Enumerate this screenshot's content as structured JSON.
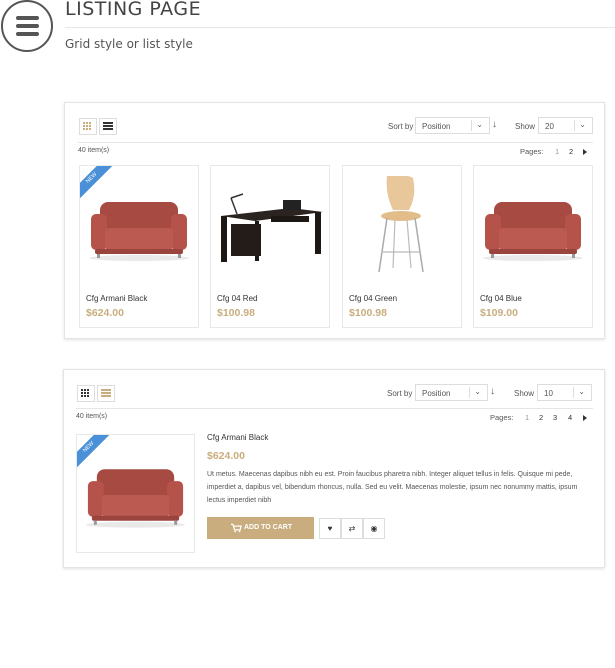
{
  "header": {
    "title": "LISTING PAGE",
    "subtitle": "Grid style or list style"
  },
  "grid_panel": {
    "sort_label": "Sort by",
    "sort_value": "Position",
    "show_label": "Show",
    "show_value": "20",
    "count": "40 item(s)",
    "pages_label": "Pages:",
    "pages": [
      "1",
      "2"
    ],
    "current_page": "1",
    "products": [
      {
        "name": "Cfg Armani Black",
        "price": "$624.00",
        "image": "red-sofa",
        "badge": "NEW"
      },
      {
        "name": "Cfg 04 Red",
        "price": "$100.98",
        "image": "black-desk"
      },
      {
        "name": "Cfg 04 Green",
        "price": "$100.98",
        "image": "bar-stool"
      },
      {
        "name": "Cfg 04 Blue",
        "price": "$109.00",
        "image": "red-sofa"
      }
    ]
  },
  "list_panel": {
    "sort_label": "Sort by",
    "sort_value": "Position",
    "show_label": "Show",
    "show_value": "10",
    "count": "40 item(s)",
    "pages_label": "Pages:",
    "pages": [
      "1",
      "2",
      "3",
      "4"
    ],
    "current_page": "1",
    "product": {
      "name": "Cfg Armani Black",
      "price": "$624.00",
      "badge": "NEW",
      "image": "red-sofa",
      "description": "Ut metus. Maecenas dapibus nibh eu est. Proin faucibus pharetra nibh. Integer aliquet tellus in felis. Quisque mi pede, imperdiet a, dapibus vel, bibendum rhoncus, nulla. Sed eu velit. Maecenas molestie, ipsum nec nonummy mattis, ipsum lectus imperdiet nibh",
      "add_to_cart": "ADD TO CART"
    }
  },
  "colors": {
    "accent_gold": "#c9ad7e",
    "badge_blue": "#4a90d9",
    "sofa_red": "#b5534a"
  }
}
